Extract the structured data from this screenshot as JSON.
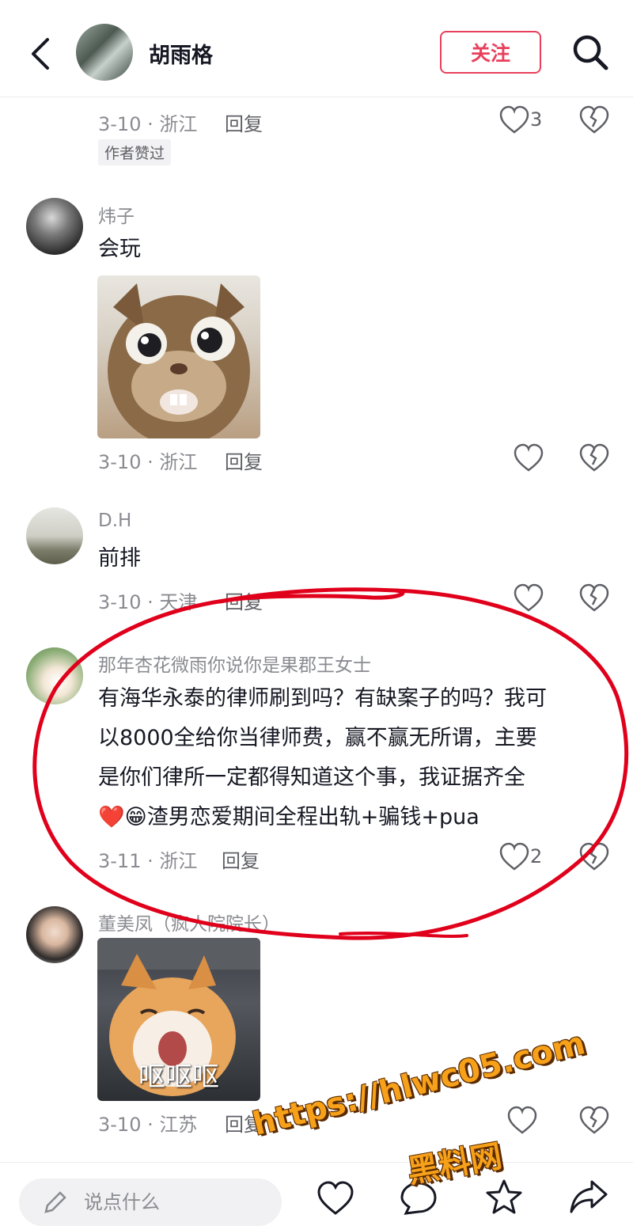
{
  "header": {
    "name": "胡雨格",
    "follow_label": "关注"
  },
  "comments": [
    {
      "meta": "3-10 · 浙江",
      "reply": "回复",
      "likes": "3",
      "tag": "作者赞过"
    },
    {
      "user": "炜子",
      "text": "会玩",
      "meta": "3-10 · 浙江",
      "reply": "回复"
    },
    {
      "user": "D.H",
      "text": "前排",
      "meta": "3-10 · 天津",
      "reply": "回复"
    },
    {
      "user": "那年杏花微雨你说你是果郡王女士",
      "line1": "有海华永泰的律师刷到吗？有缺案子的吗？我可",
      "line2": "以8000全给你当律师费，赢不赢无所谓，主要",
      "line3": "是你们律所一定都得知道这个事，我证据齐全",
      "emoji": "❤️😁",
      "line4": "渣男恋爱期间全程出轨+骗钱+pua",
      "meta": "3-11 · 浙江",
      "reply": "回复",
      "likes": "2"
    },
    {
      "user": "董美凤（疯人院院长）",
      "sticker_caption": "呕呕呕",
      "meta": "3-10 · 江苏",
      "reply": "回复"
    }
  ],
  "bottom": {
    "placeholder": "说点什么"
  },
  "watermark": {
    "line1": "https://hlwc05.com",
    "line2": "黑料网"
  },
  "colors": {
    "accent": "#e8405c",
    "annotation": "#e0001b",
    "watermark": "#f7a11a"
  }
}
